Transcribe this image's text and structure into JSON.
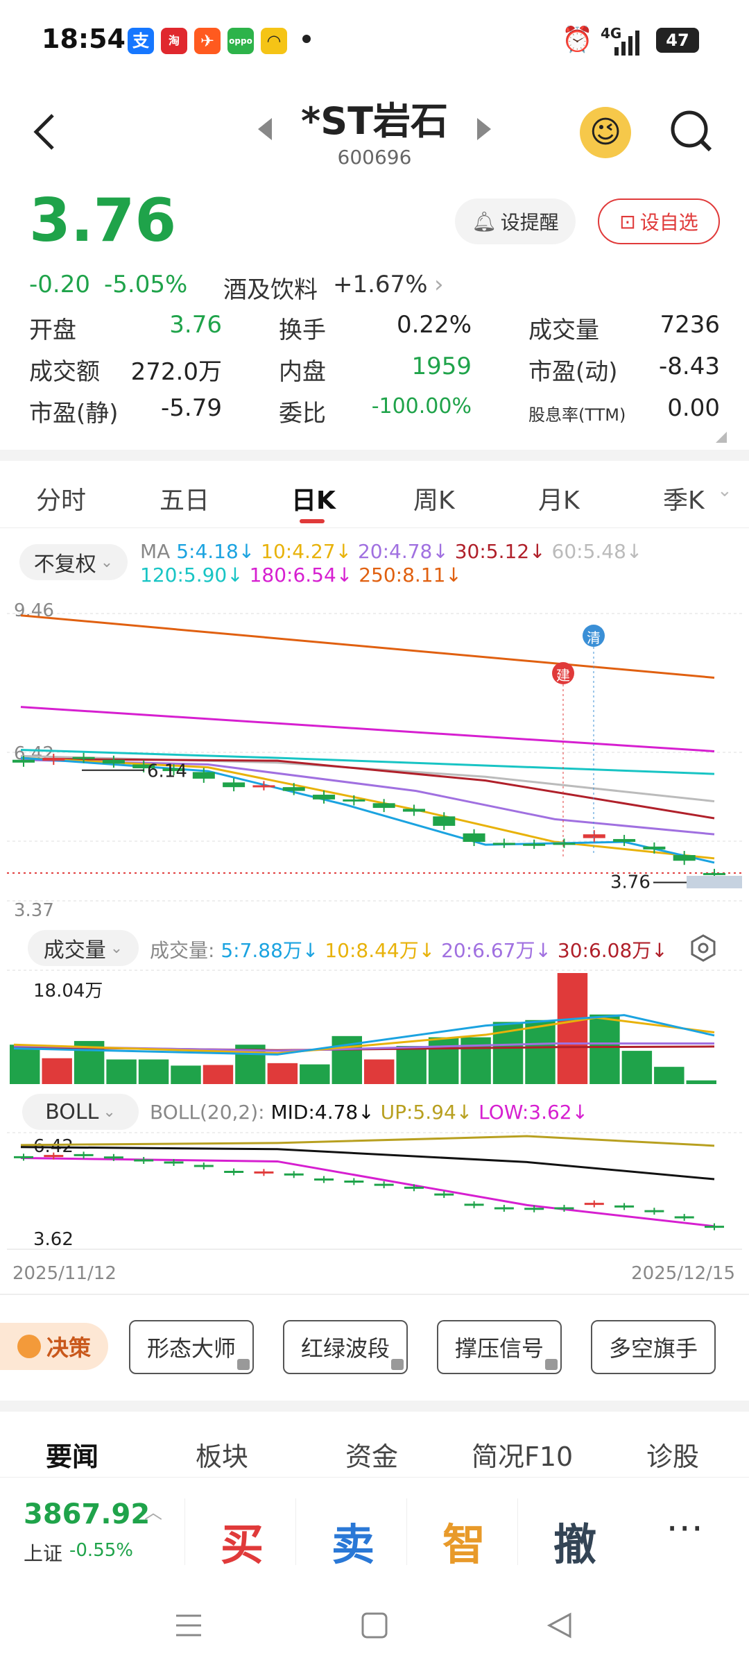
{
  "status_bar": {
    "time": "18:54",
    "battery": "47",
    "network": "4G"
  },
  "header": {
    "title": "*ST岩石",
    "code": "600696"
  },
  "quote": {
    "price": "3.76",
    "change": "-0.20",
    "change_pct": "-5.05%",
    "sector": "酒及饮料",
    "sector_change": "+1.67%",
    "alert_label": "设提醒",
    "watchlist_label": "设自选"
  },
  "stats": [
    [
      {
        "label": "开盘",
        "value": "3.76",
        "color": "#1fa34a"
      },
      {
        "label": "换手",
        "value": "0.22%",
        "color": "#222"
      },
      {
        "label": "成交量",
        "value": "7236",
        "color": "#222"
      }
    ],
    [
      {
        "label": "成交额",
        "value": "272.0万",
        "color": "#222"
      },
      {
        "label": "内盘",
        "value": "1959",
        "color": "#1fa34a"
      },
      {
        "label": "市盈(动)",
        "value": "-8.43",
        "color": "#222"
      }
    ],
    [
      {
        "label": "市盈(静)",
        "value": "-5.79",
        "color": "#222"
      },
      {
        "label": "委比",
        "value": "-100.00%",
        "color": "#1fa34a"
      },
      {
        "label": "股息率(TTM)",
        "value": "0.00",
        "color": "#222"
      }
    ]
  ],
  "tabs": [
    "分时",
    "五日",
    "日K",
    "周K",
    "月K",
    "季K"
  ],
  "active_tab": 2,
  "ma_legend": {
    "adjust": "不复权",
    "prefix": "MA",
    "items": [
      {
        "text": "5:4.18↓",
        "color": "#1ba3e0"
      },
      {
        "text": "10:4.27↓",
        "color": "#e8b20a"
      },
      {
        "text": "20:4.78↓",
        "color": "#a070e0"
      },
      {
        "text": "30:5.12↓",
        "color": "#b0202a"
      },
      {
        "text": "60:5.48↓",
        "color": "#bbbbbb"
      },
      {
        "text": "120:5.90↓",
        "color": "#18c4c4"
      },
      {
        "text": "180:6.54↓",
        "color": "#d61fd0"
      },
      {
        "text": "250:8.11↓",
        "color": "#e06010"
      }
    ]
  },
  "price_chart": {
    "axis_top": "9.46",
    "axis_mid": "6.42",
    "axis_bottom": "3.37",
    "high_label": "6.14",
    "last_label": "3.76",
    "marker_jian": "建",
    "marker_qing": "清"
  },
  "volume_legend": {
    "selector": "成交量",
    "prefix": "成交量:",
    "items": [
      {
        "text": "5:7.88万↓",
        "color": "#1ba3e0"
      },
      {
        "text": "10:8.44万↓",
        "color": "#e8b20a"
      },
      {
        "text": "20:6.67万↓",
        "color": "#a070e0"
      },
      {
        "text": "30:6.08万↓",
        "color": "#b0202a"
      }
    ],
    "max_label": "18.04万"
  },
  "boll_legend": {
    "selector": "BOLL",
    "prefix": "BOLL(20,2):",
    "items": [
      {
        "text": "MID:4.78↓",
        "color": "#111111"
      },
      {
        "text": "UP:5.94↓",
        "color": "#b8a020"
      },
      {
        "text": "LOW:3.62↓",
        "color": "#d61fd0"
      }
    ],
    "axis_top": "6.42",
    "axis_bottom": "3.62"
  },
  "date_range": {
    "start": "2025/11/12",
    "end": "2025/12/15"
  },
  "tools": {
    "decision": "决策",
    "buttons": [
      "形态大师",
      "红绿波段",
      "撑压信号",
      "多空旗手"
    ]
  },
  "bottom_tabs": [
    "要闻",
    "板块",
    "资金",
    "简况F10",
    "诊股"
  ],
  "index": {
    "value": "3867.92",
    "name": "上证",
    "change": "-0.55%"
  },
  "actions": [
    {
      "label": "买",
      "color": "#e03a3a"
    },
    {
      "label": "卖",
      "color": "#2a78d6"
    },
    {
      "label": "智",
      "color": "#e89a2a"
    },
    {
      "label": "撤",
      "color": "#345"
    }
  ],
  "more_label": "⋯",
  "chart_data": {
    "type": "candlestick",
    "candles": [
      {
        "o": 6.36,
        "c": 6.3
      },
      {
        "o": 6.34,
        "c": 6.4
      },
      {
        "o": 6.42,
        "c": 6.38
      },
      {
        "o": 6.36,
        "c": 6.28
      },
      {
        "o": 6.26,
        "c": 6.18
      },
      {
        "o": 6.18,
        "c": 6.12
      },
      {
        "o": 6.1,
        "c": 5.96
      },
      {
        "o": 5.88,
        "c": 5.78
      },
      {
        "o": 5.8,
        "c": 5.82
      },
      {
        "o": 5.78,
        "c": 5.7
      },
      {
        "o": 5.62,
        "c": 5.52
      },
      {
        "o": 5.52,
        "c": 5.48
      },
      {
        "o": 5.44,
        "c": 5.34
      },
      {
        "o": 5.32,
        "c": 5.26
      },
      {
        "o": 5.16,
        "c": 4.96
      },
      {
        "o": 4.8,
        "c": 4.62
      },
      {
        "o": 4.6,
        "c": 4.58
      },
      {
        "o": 4.58,
        "c": 4.56
      },
      {
        "o": 4.6,
        "c": 4.58
      },
      {
        "o": 4.7,
        "c": 4.78
      },
      {
        "o": 4.68,
        "c": 4.62
      },
      {
        "o": 4.52,
        "c": 4.46
      },
      {
        "o": 4.34,
        "c": 4.22
      },
      {
        "o": 3.96,
        "c": 3.96
      }
    ],
    "volume": [
      6.4,
      4.2,
      7.0,
      4.0,
      4.0,
      3.0,
      3.1,
      6.4,
      3.4,
      3.2,
      7.8,
      4.0,
      6.2,
      7.6,
      7.6,
      10.1,
      10.4,
      18.04,
      11.3,
      5.4,
      2.8,
      0.6
    ],
    "volume_up": [
      false,
      true,
      false,
      false,
      false,
      false,
      true,
      false,
      true,
      false,
      false,
      true,
      false,
      false,
      false,
      false,
      false,
      true,
      false,
      false,
      false,
      false
    ]
  }
}
